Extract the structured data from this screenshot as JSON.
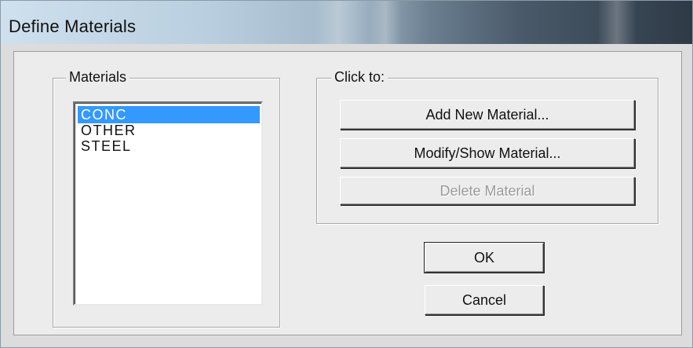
{
  "window": {
    "title": "Define Materials"
  },
  "materials_group": {
    "caption": "Materials",
    "items": [
      {
        "label": "CONC",
        "selected": true
      },
      {
        "label": "OTHER",
        "selected": false
      },
      {
        "label": "STEEL",
        "selected": false
      }
    ]
  },
  "actions_group": {
    "caption": "Click to:",
    "add_label": "Add New Material...",
    "modify_label": "Modify/Show Material...",
    "delete_label": "Delete Material",
    "delete_enabled": false
  },
  "footer": {
    "ok_label": "OK",
    "cancel_label": "Cancel"
  },
  "colors": {
    "selection": "#3399ff",
    "dialog_face": "#ececec"
  }
}
